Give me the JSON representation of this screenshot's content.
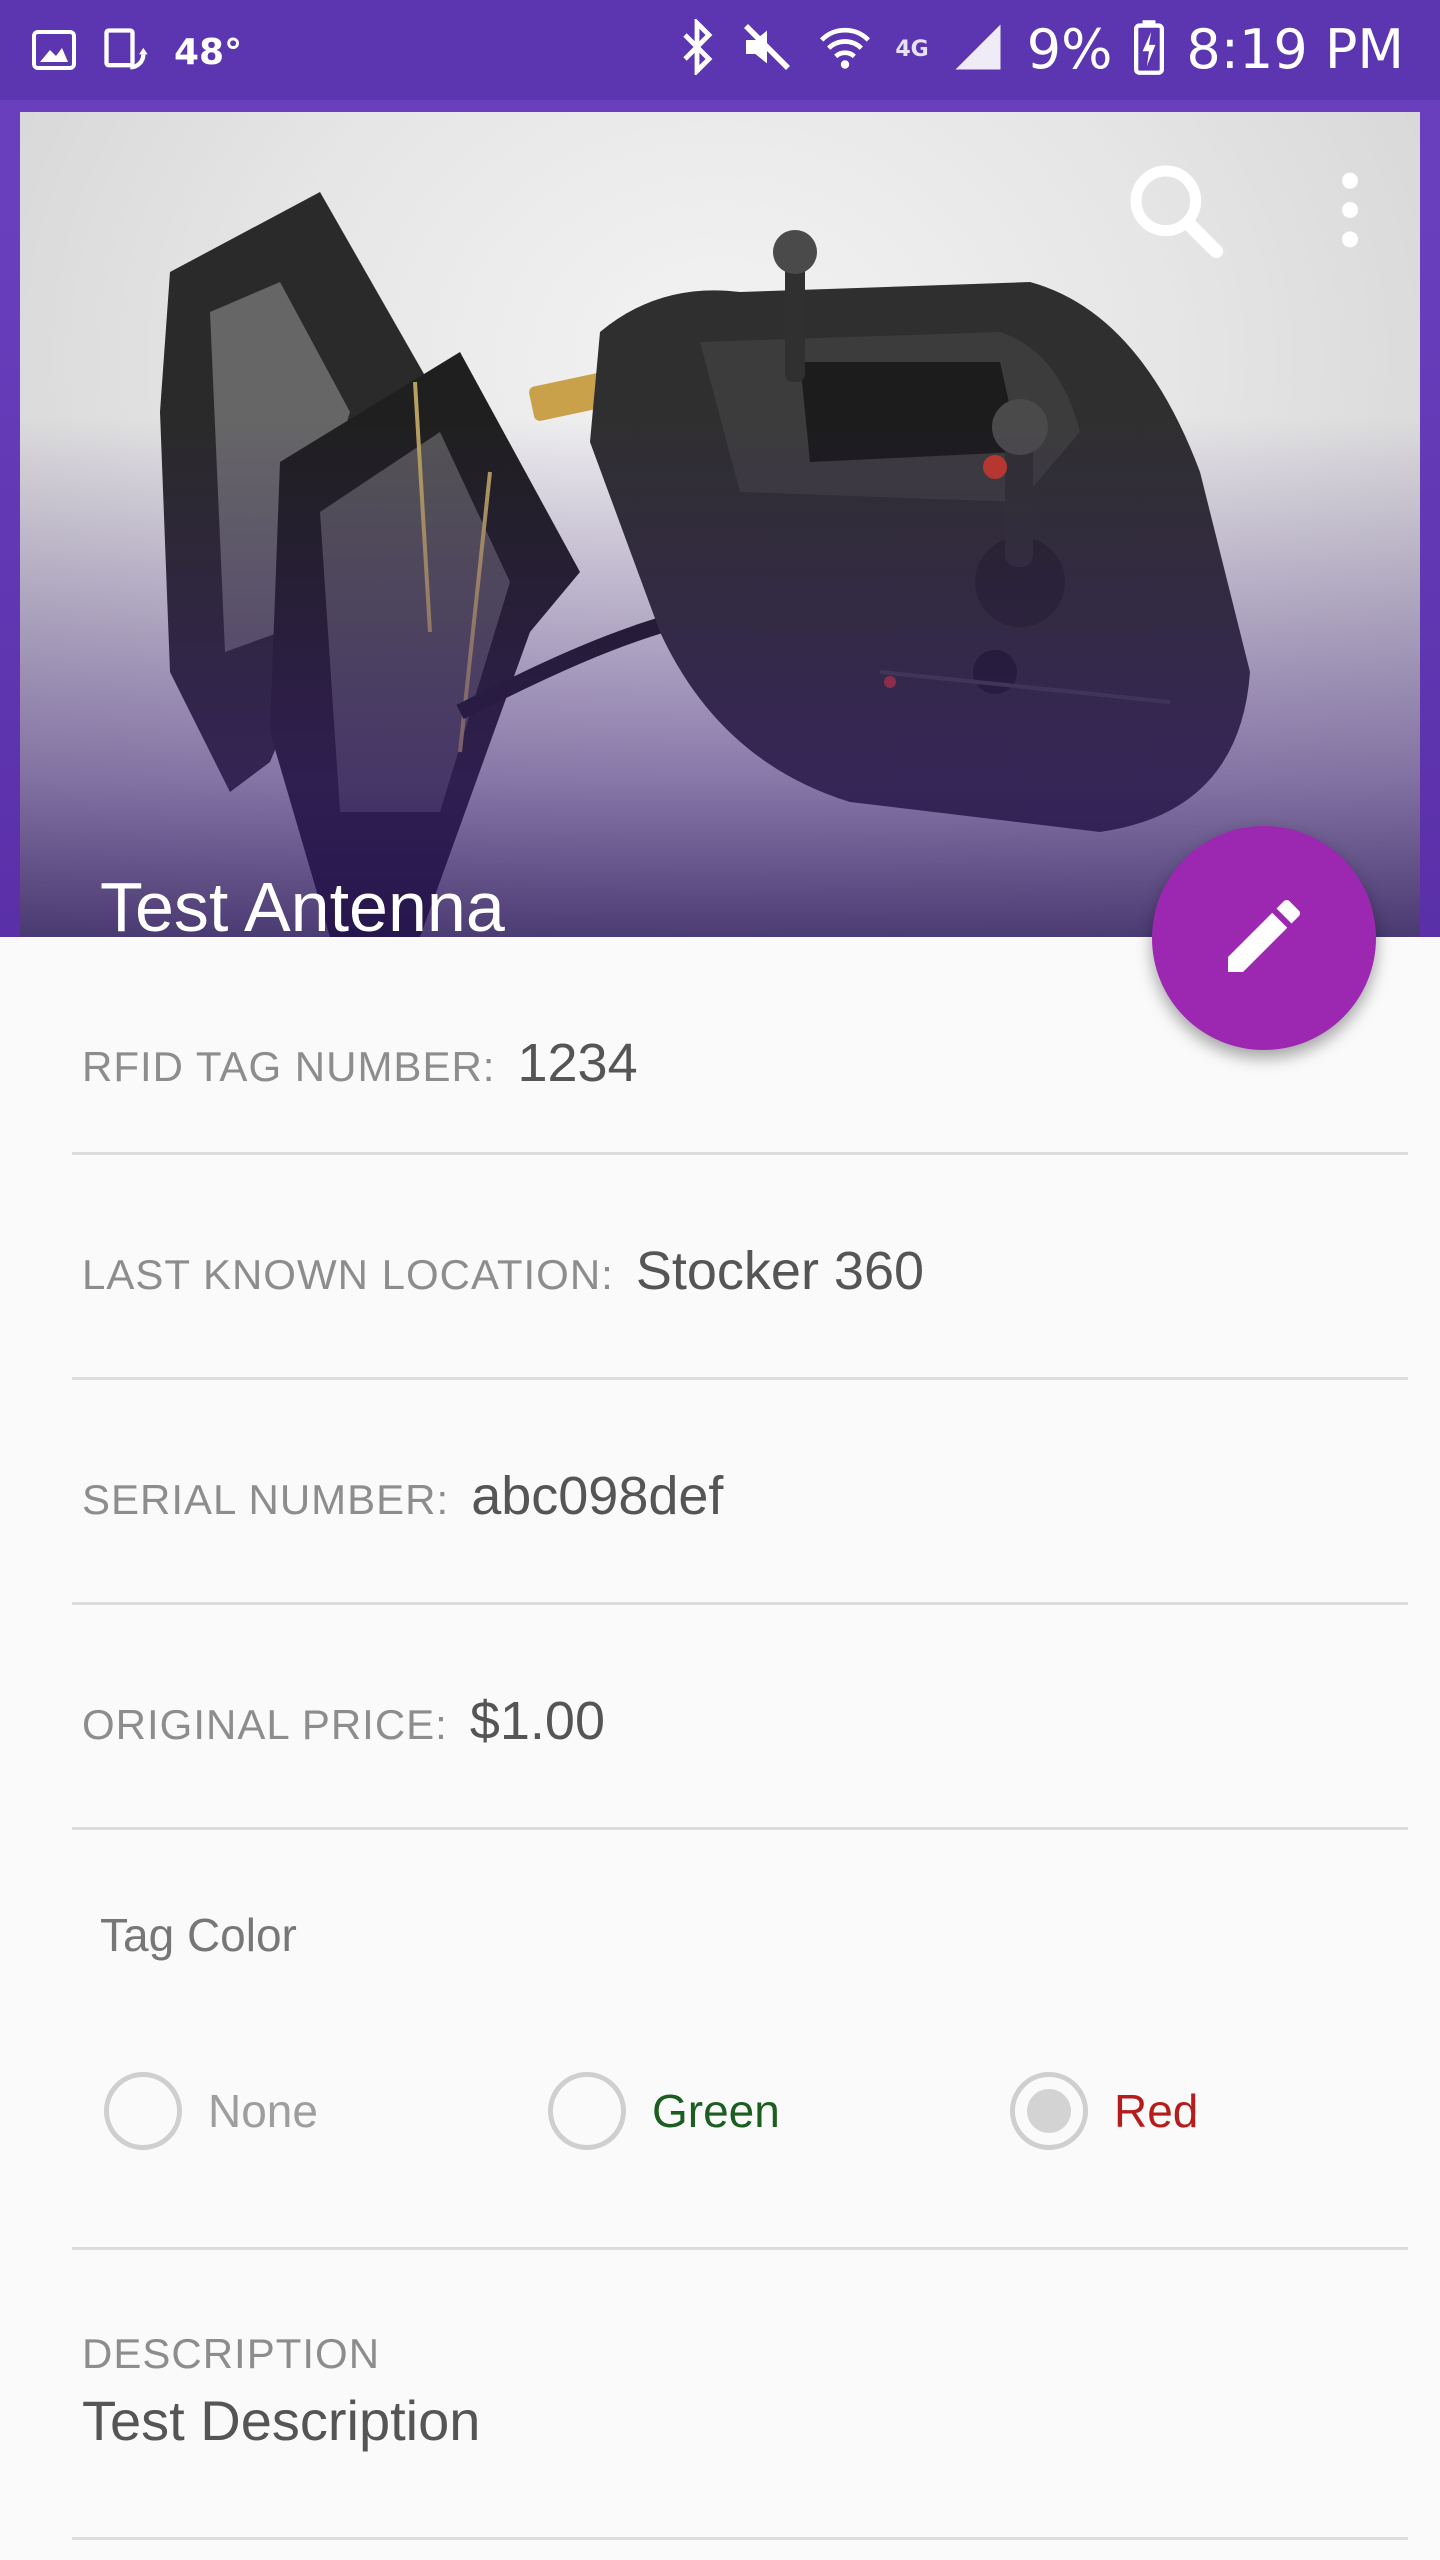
{
  "status_bar": {
    "temperature": "48°",
    "lte": "4G",
    "battery": "9%",
    "time": "8:19 PM"
  },
  "item": {
    "title": "Test Antenna"
  },
  "fields": [
    {
      "label": "RFID TAG NUMBER:",
      "value": "1234"
    },
    {
      "label": "LAST KNOWN LOCATION:",
      "value": "Stocker 360"
    },
    {
      "label": "SERIAL NUMBER:",
      "value": "abc098def"
    },
    {
      "label": "ORIGINAL PRICE:",
      "value": "$1.00"
    }
  ],
  "tag_color": {
    "title": "Tag Color",
    "options": [
      {
        "label": "None",
        "color": "#9e9e9e"
      },
      {
        "label": "Green",
        "color": "#1b5e20"
      },
      {
        "label": "Red",
        "color": "#b71c1c"
      }
    ],
    "selected": "Red"
  },
  "description": {
    "label": "DESCRIPTION",
    "value": "Test Description"
  },
  "colors": {
    "status_bar": "#5b36b0",
    "app_bar": "#6a3fbe",
    "fab": "#9c27b0"
  },
  "icons": [
    "image-icon",
    "rotation-icon",
    "bluetooth-icon",
    "mute-icon",
    "wifi-icon",
    "signal-icon",
    "battery-charging-icon",
    "search-icon",
    "more-vert-icon",
    "edit-icon"
  ]
}
